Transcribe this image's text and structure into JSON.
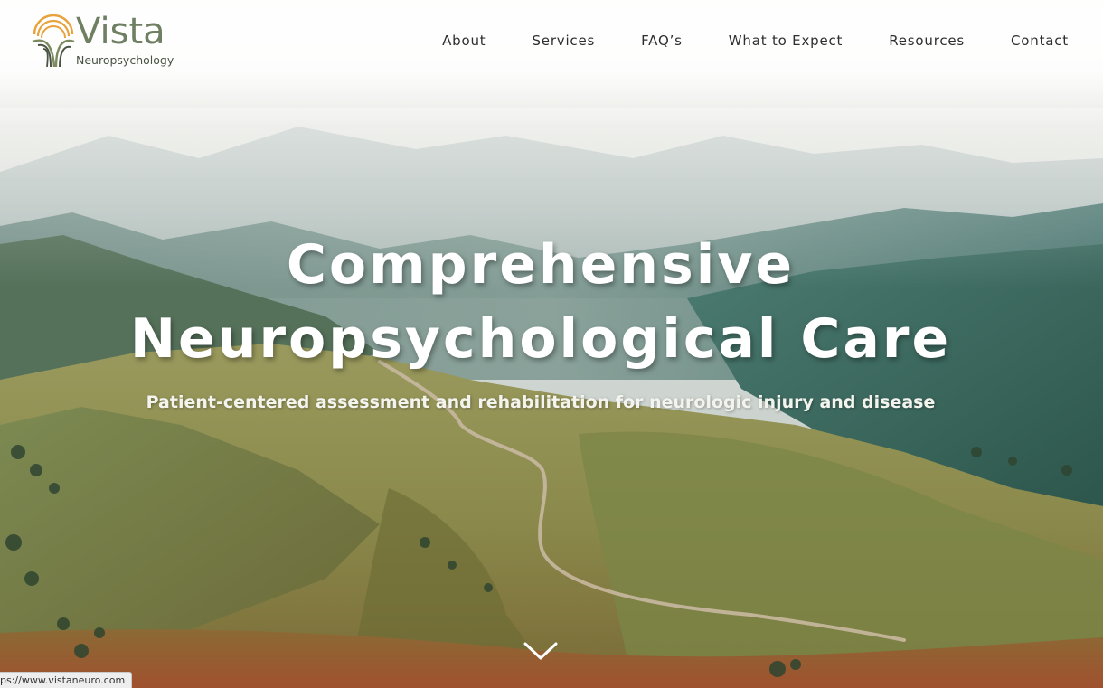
{
  "brand": {
    "name": "Vista",
    "subtitle": "Neuropsychology",
    "colors": {
      "wordmark": "#6f7f62",
      "arc_orange": "#e8a23c",
      "arc_green": "#7a8a5c",
      "lines_dark": "#4a5444"
    }
  },
  "nav": {
    "items": [
      {
        "label": "About"
      },
      {
        "label": "Services"
      },
      {
        "label": "FAQ’s"
      },
      {
        "label": "What to Expect"
      },
      {
        "label": "Resources"
      },
      {
        "label": "Contact"
      }
    ]
  },
  "hero": {
    "title_line1": "Comprehensive",
    "title_line2": "Neuropsychological Care",
    "subtitle": "Patient-centered assessment and rehabilitation for neurologic injury and disease",
    "scroll_icon": "chevron-down-icon"
  },
  "status_bar": {
    "url": "ps://www.vistaneuro.com"
  }
}
